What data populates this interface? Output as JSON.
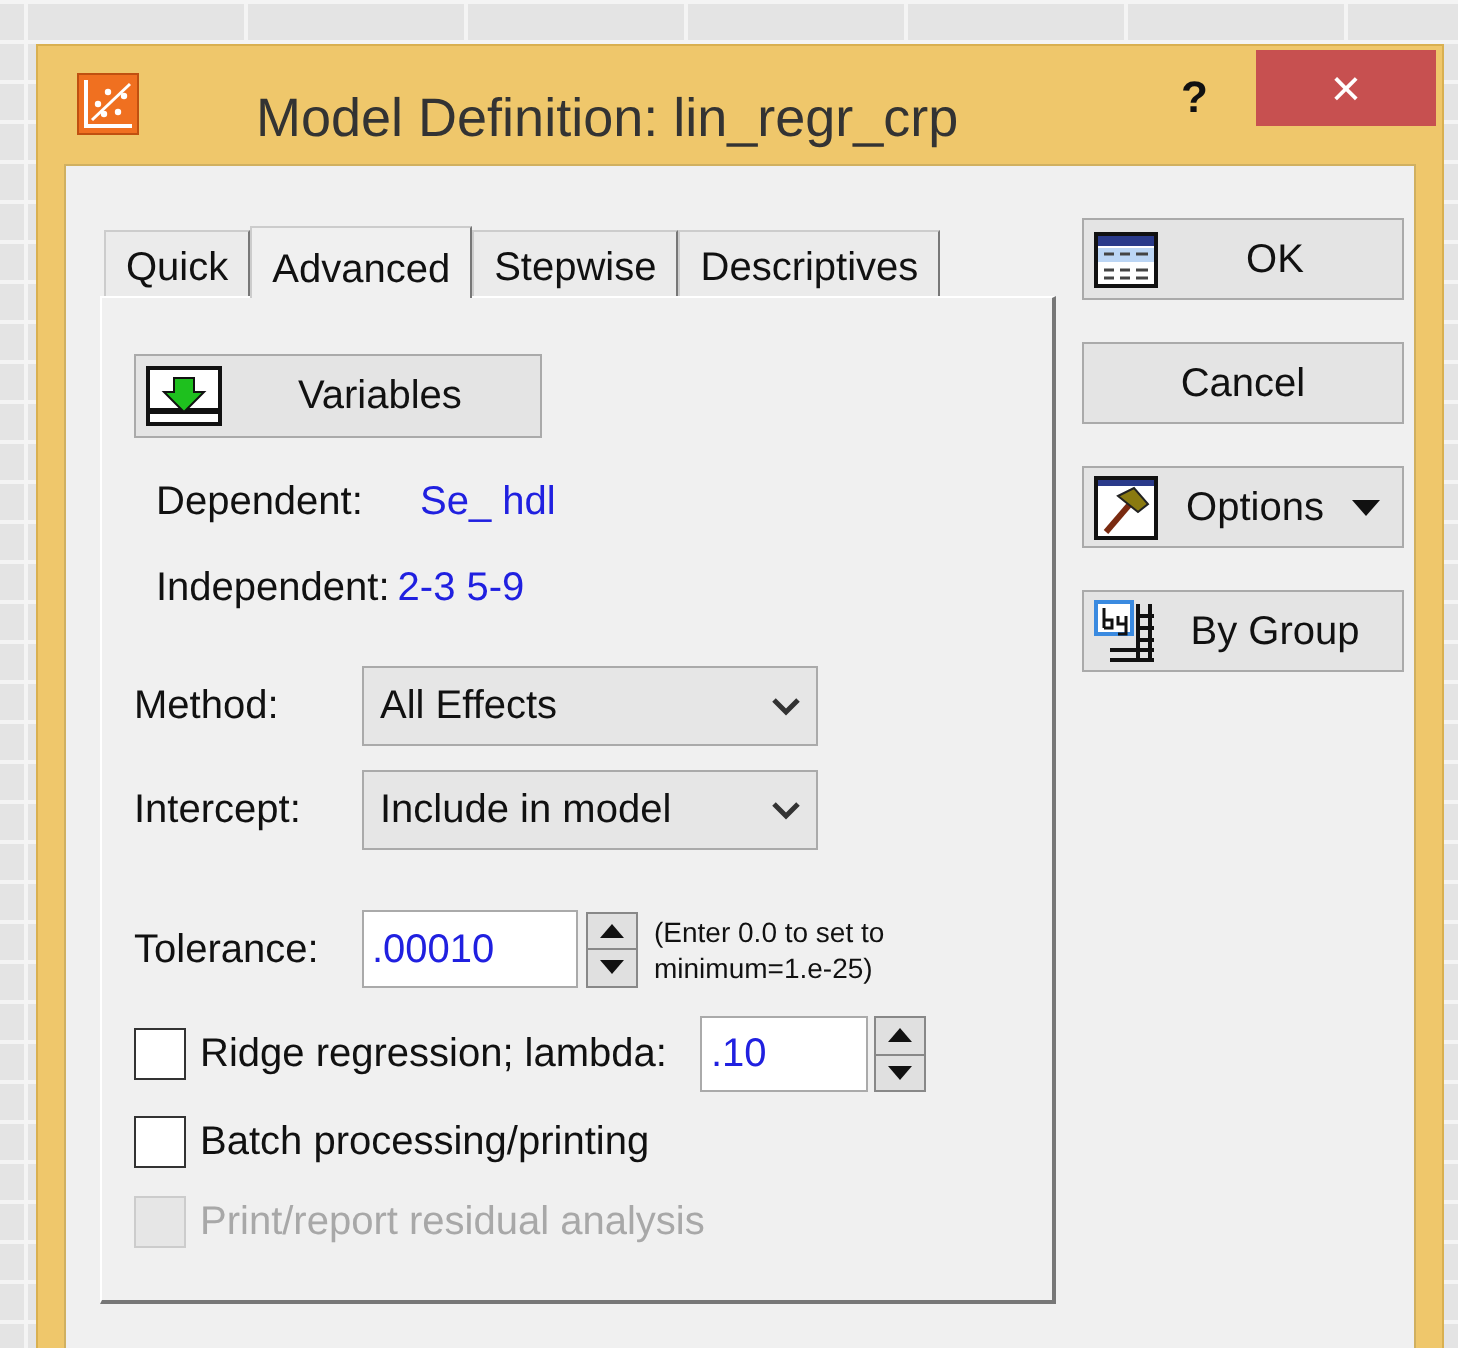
{
  "window": {
    "title": "Model Definition: lin_regr_crp",
    "help": "?",
    "close": "×"
  },
  "tabs": [
    {
      "label": "Quick",
      "selected": false
    },
    {
      "label": "Advanced",
      "selected": true
    },
    {
      "label": "Stepwise",
      "selected": false
    },
    {
      "label": "Descriptives",
      "selected": false
    }
  ],
  "variables_button": "Variables",
  "dependent": {
    "label": "Dependent:",
    "value": "Se_ hdl"
  },
  "independent": {
    "label": "Independent:",
    "value": "2-3 5-9"
  },
  "method": {
    "label": "Method:",
    "value": "All Effects"
  },
  "intercept": {
    "label": "Intercept:",
    "value": "Include in model"
  },
  "tolerance": {
    "label": "Tolerance:",
    "value": ".00010",
    "hint": "(Enter 0.0 to set to minimum=1.e-25)"
  },
  "checkboxes": [
    {
      "kind": "with-spin",
      "label": "Ridge regression; lambda:",
      "checked": false,
      "disabled": false,
      "value": ".10"
    },
    {
      "kind": "plain",
      "label": "Batch processing/printing",
      "checked": false,
      "disabled": false
    },
    {
      "kind": "plain",
      "label": "Print/report residual analysis",
      "checked": false,
      "disabled": true
    }
  ],
  "buttons": [
    {
      "kind": "table",
      "label": "OK"
    },
    {
      "kind": "plain",
      "label": "Cancel"
    },
    {
      "kind": "menu",
      "label": "Options"
    },
    {
      "kind": "by-group",
      "label": "By Group"
    }
  ]
}
